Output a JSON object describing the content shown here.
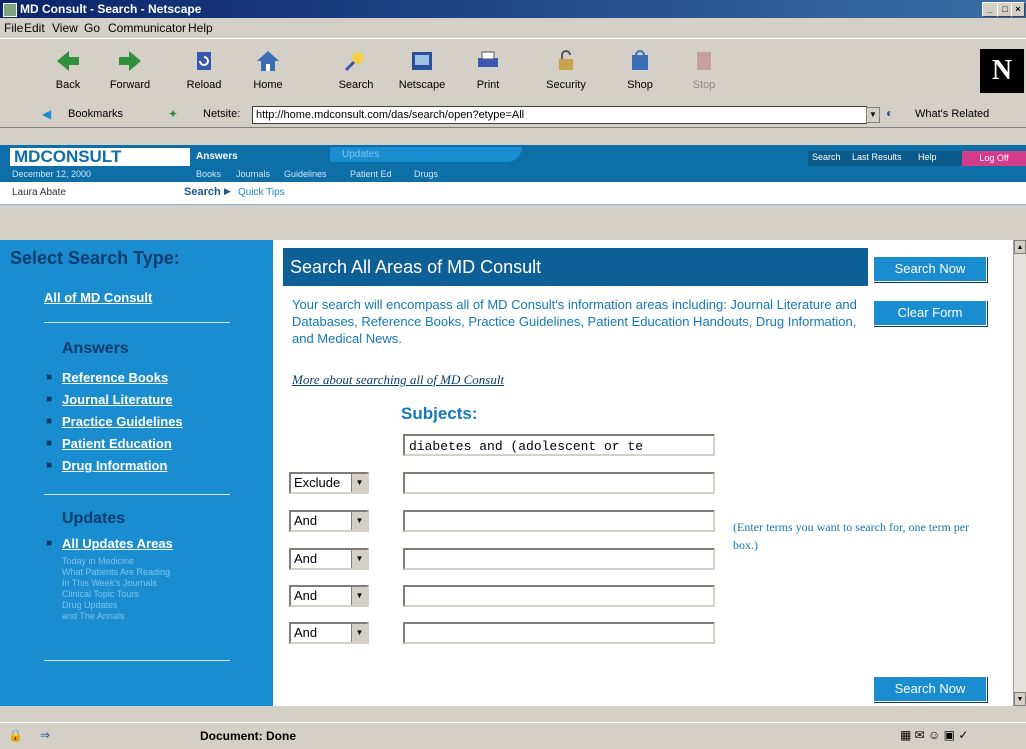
{
  "window": {
    "title": "MD Consult - Search - Netscape"
  },
  "menu": [
    "File",
    "Edit",
    "View",
    "Go",
    "Communicator",
    "Help"
  ],
  "toolbar": [
    {
      "label": "Back",
      "icon": "back-arrow-icon"
    },
    {
      "label": "Forward",
      "icon": "forward-arrow-icon"
    },
    {
      "label": "Reload",
      "icon": "reload-icon"
    },
    {
      "label": "Home",
      "icon": "home-icon"
    },
    {
      "label": "Search",
      "icon": "search-icon"
    },
    {
      "label": "Netscape",
      "icon": "netscape-icon"
    },
    {
      "label": "Print",
      "icon": "print-icon"
    },
    {
      "label": "Security",
      "icon": "security-icon"
    },
    {
      "label": "Shop",
      "icon": "shop-icon"
    },
    {
      "label": "Stop",
      "icon": "stop-icon"
    }
  ],
  "location": {
    "bookmarks": "Bookmarks",
    "netsite_label": "Netsite:",
    "url": "http://home.mdconsult.com/das/search/open?etype=All",
    "whats_related": "What's Related"
  },
  "brand": {
    "logo": "MDCONSULT",
    "date": "December 12, 2000"
  },
  "topnav": {
    "answers": "Answers",
    "updates": "Updates",
    "links": [
      "Books",
      "Journals",
      "Guidelines",
      "Patient Ed",
      "Drugs"
    ]
  },
  "rightnav": [
    "Search",
    "Last Results",
    "Help",
    "Log Off"
  ],
  "subbar": {
    "user": "Laura Abate",
    "search": "Search",
    "quick_tips": "Quick Tips"
  },
  "sidebar": {
    "heading": "Select Search Type:",
    "all": "All of MD Consult",
    "answers_heading": "Answers",
    "answers": [
      "Reference Books",
      "Journal Literature",
      "Practice Guidelines",
      "Patient Education",
      "Drug Information"
    ],
    "updates_heading": "Updates",
    "all_updates": "All Updates Areas",
    "updates": [
      "Today in Medicine",
      "What Patients Are Reading",
      "In This Week's Journals",
      "Clinical Topic Tours",
      "Drug Updates",
      "and The Annals"
    ]
  },
  "main": {
    "heading": "Search All Areas of MD Consult",
    "description": "Your search will encompass all of MD Consult's information areas including: Journal Literature and Databases, Reference Books, Practice Guidelines, Patient Education Handouts, Drug Information, and Medical News.",
    "more_link": "More about searching all of MD Consult",
    "subjects_label": "Subjects:",
    "first_term": "diabetes and (adolescent or te",
    "rows": [
      {
        "operator": "Exclude",
        "value": ""
      },
      {
        "operator": "And",
        "value": ""
      },
      {
        "operator": "And",
        "value": ""
      },
      {
        "operator": "And",
        "value": ""
      },
      {
        "operator": "And",
        "value": ""
      }
    ],
    "hint": "(Enter terms you want to search for, one term per box.)",
    "search_now": "Search Now",
    "clear_form": "Clear Form"
  },
  "status": {
    "text": "Document: Done"
  },
  "colors": {
    "brand_blue": "#0d6ea8",
    "sidebar_blue": "#1a8cd0",
    "log_off": "#d33c8a"
  }
}
